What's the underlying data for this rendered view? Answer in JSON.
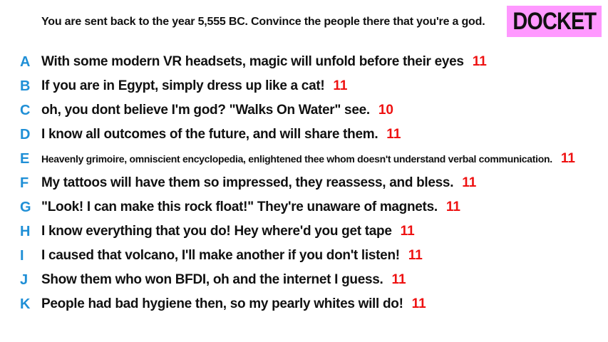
{
  "prompt": "You are sent back to the year 5,555 BC. Convince the people there that you're a god.",
  "badge": {
    "label": "DOCKET",
    "color": "#ff99ff"
  },
  "colors": {
    "letter": "#1f8fd6",
    "score": "#ee1111",
    "text": "#111111"
  },
  "answers": [
    {
      "letter": "A",
      "text": "With some modern VR headsets, magic will unfold before their eyes",
      "score": "11"
    },
    {
      "letter": "B",
      "text": "If you are in Egypt, simply dress up like a cat!",
      "score": "11"
    },
    {
      "letter": "C",
      "text": "oh, you dont believe I'm god? \"Walks On Water\" see.",
      "score": "10"
    },
    {
      "letter": "D",
      "text": "I know all outcomes of the future, and will share them.",
      "score": "11"
    },
    {
      "letter": "E",
      "text": "Heavenly grimoire, omniscient encyclopedia, enlightened thee whom doesn't understand verbal communication.",
      "score": "11"
    },
    {
      "letter": "F",
      "text": "My tattoos will have them so impressed, they reassess, and bless.",
      "score": "11"
    },
    {
      "letter": "G",
      "text": "\"Look! I can make this rock float!\" They're unaware of magnets.",
      "score": "11"
    },
    {
      "letter": "H",
      "text": "I know everything that you do! Hey where'd you get tape",
      "score": "11"
    },
    {
      "letter": "I",
      "text": "I caused that volcano, I'll make another if you don't listen!",
      "score": "11"
    },
    {
      "letter": "J",
      "text": "Show them who won BFDI, oh and the internet I guess.",
      "score": "11"
    },
    {
      "letter": "K",
      "text": "People had bad hygiene then, so my pearly whites will do!",
      "score": "11"
    }
  ]
}
